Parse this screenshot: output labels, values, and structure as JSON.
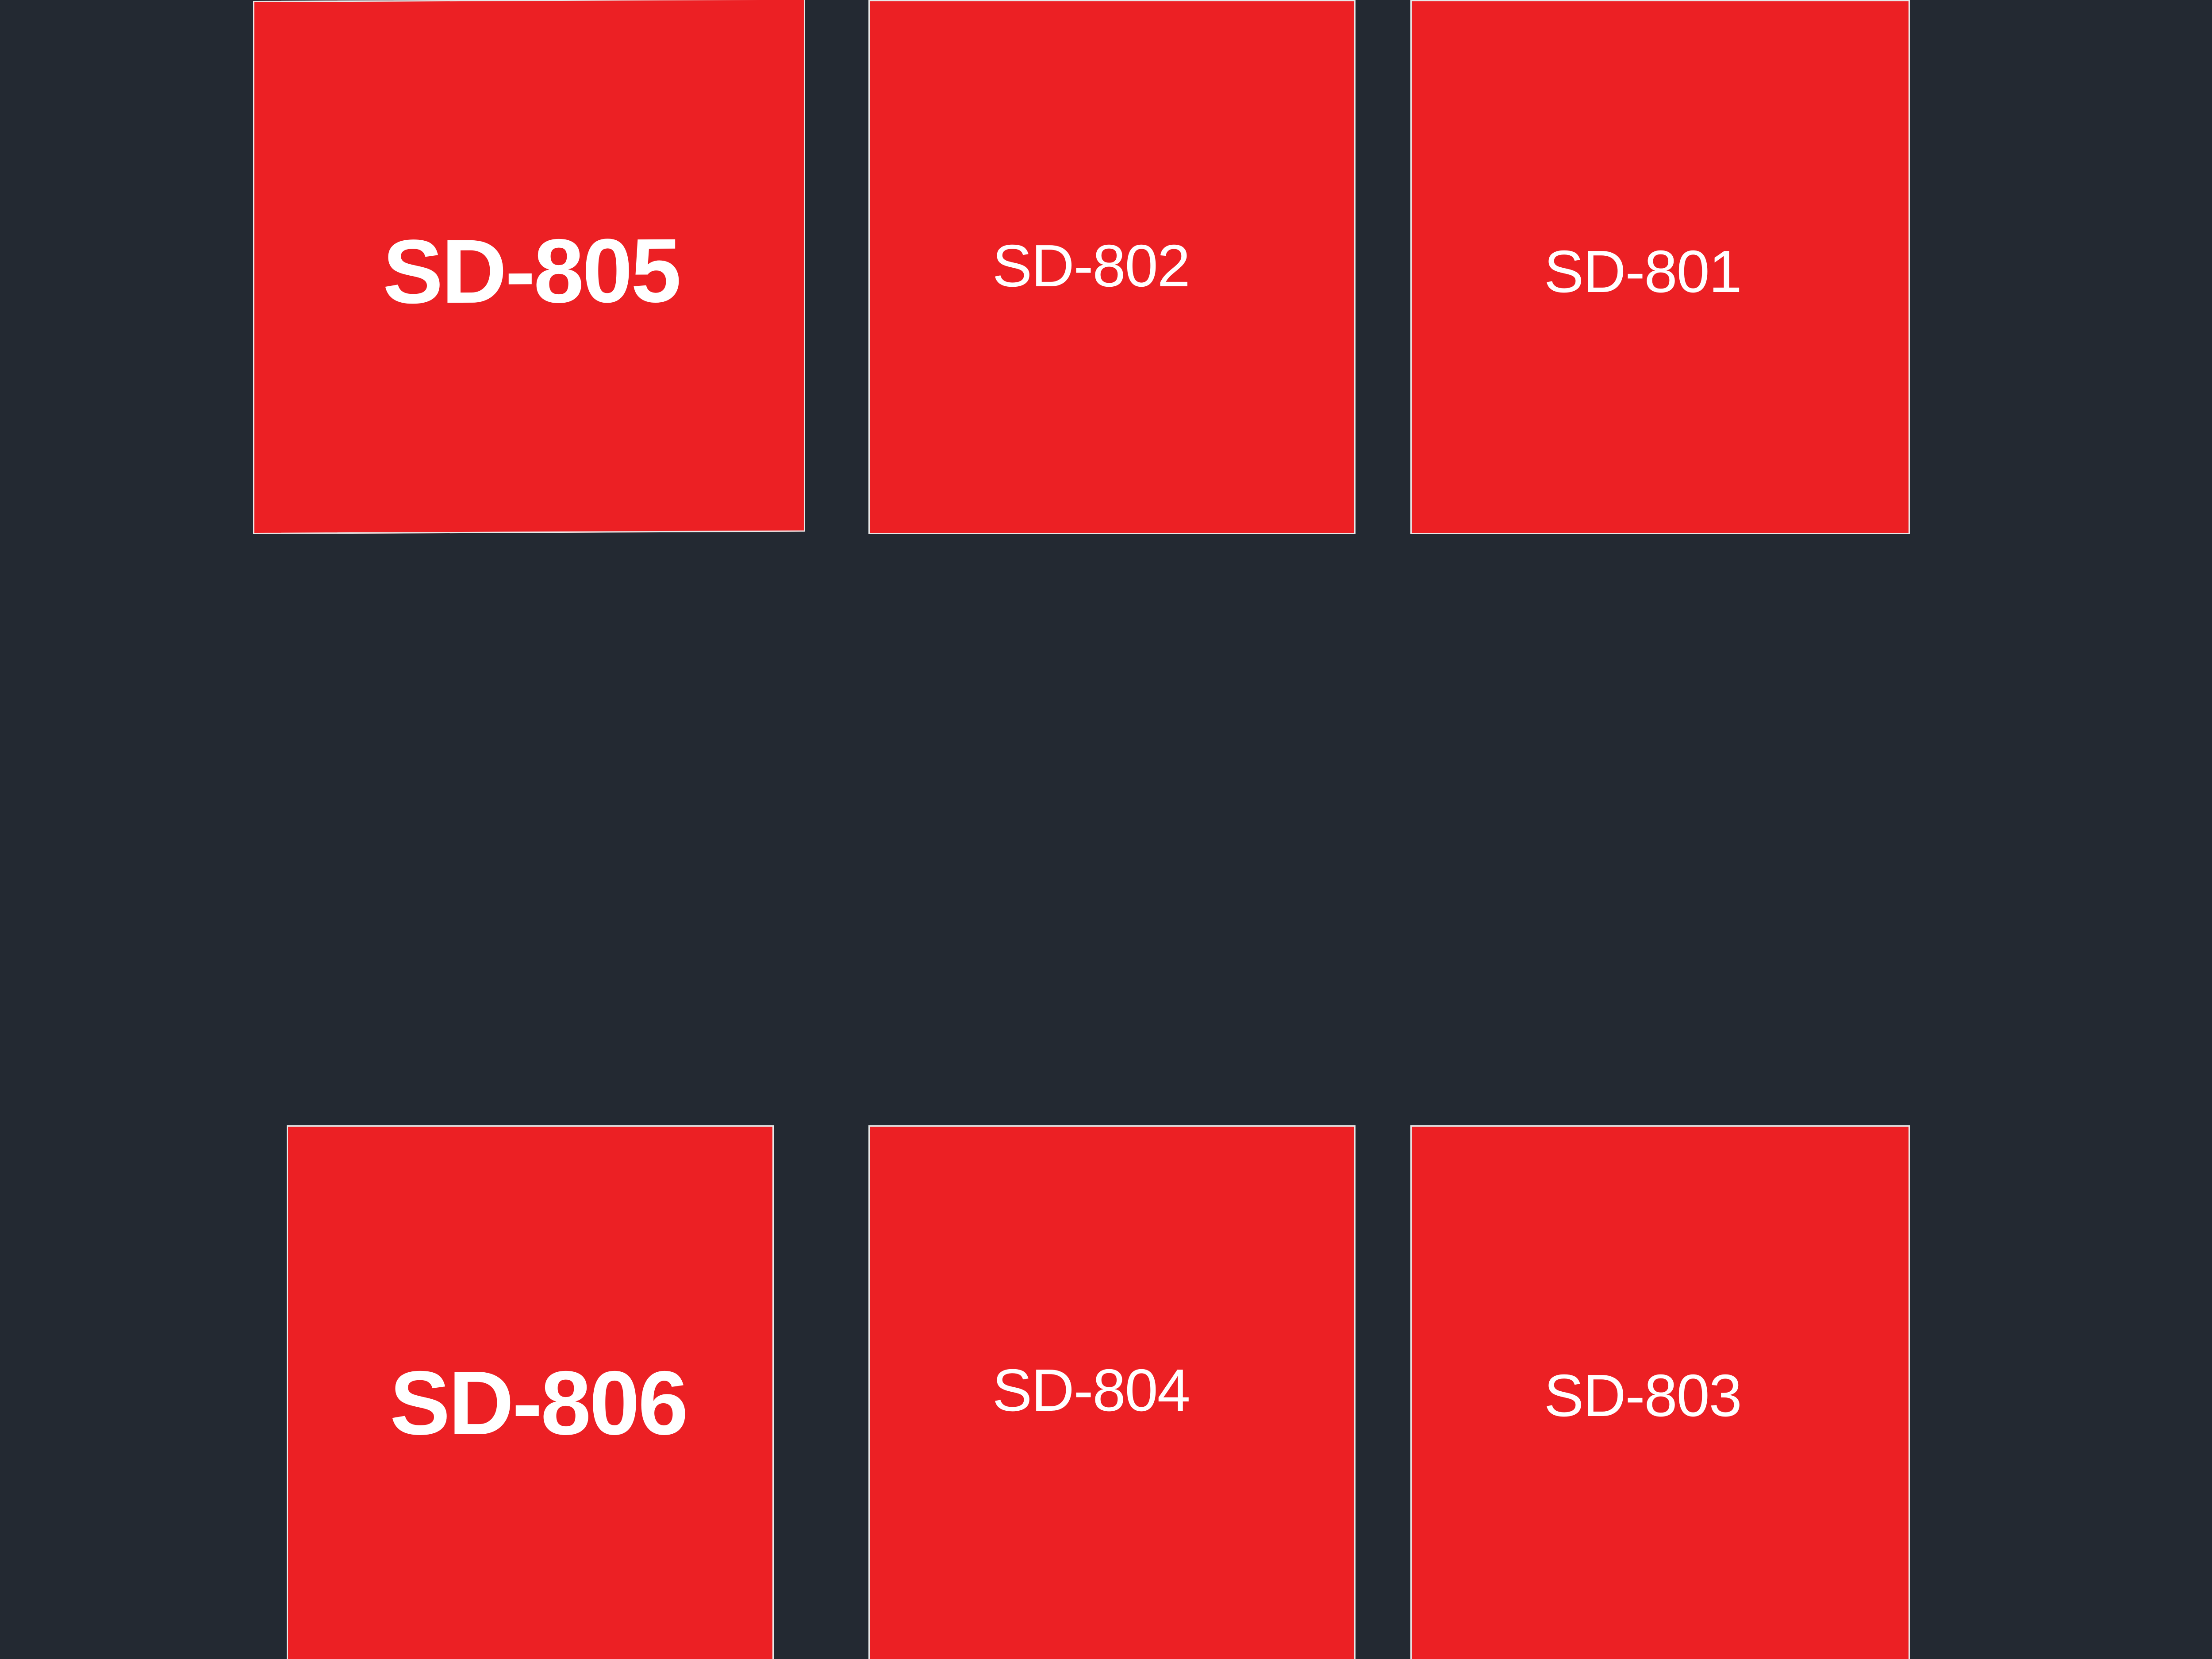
{
  "colors": {
    "background": "#232932",
    "unit_fill": "#ec2024",
    "unit_border": "#e8e8e8",
    "label": "#ffffff"
  },
  "units": {
    "u805": {
      "label": "SD-805"
    },
    "u802": {
      "label": "SD-802"
    },
    "u801": {
      "label": "SD-801"
    },
    "u806": {
      "label": "SD-806"
    },
    "u804": {
      "label": "SD-804"
    },
    "u803": {
      "label": "SD-803"
    }
  }
}
